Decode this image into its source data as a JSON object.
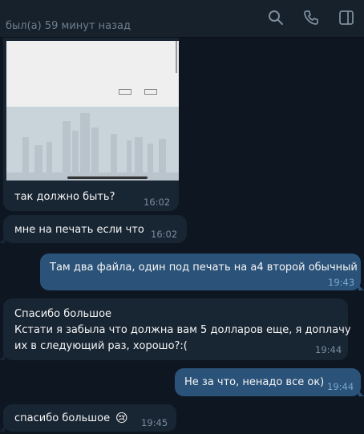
{
  "header": {
    "status": "был(а) 59 минут назад",
    "icons": [
      "search-icon",
      "phone-icon",
      "sidebar-icon"
    ]
  },
  "messages": [
    {
      "direction": "in",
      "type": "photo",
      "text": "так должно быть?",
      "time": "16:02"
    },
    {
      "direction": "in",
      "text": "мне на печать если что",
      "time": "16:02"
    },
    {
      "direction": "out",
      "text": "Там два файла, один под печать на а4 второй обычный",
      "time": "19:43"
    },
    {
      "direction": "in",
      "lines": [
        "Спасибо большое",
        "Кстати я забыла что должна вам 5 долларов еще, я доплачу",
        "их в следующий раз, хорошо?:("
      ],
      "time": "19:44"
    },
    {
      "direction": "out",
      "text": "Не за что, ненадо все ок)",
      "time": "19:44"
    },
    {
      "direction": "in",
      "text": "спасибо большое",
      "emoji": "😢",
      "time": "19:45"
    }
  ],
  "colors": {
    "background": "#0e1621",
    "header": "#17212b",
    "incoming_bubble": "#182533",
    "outgoing_bubble": "#2b5278"
  }
}
